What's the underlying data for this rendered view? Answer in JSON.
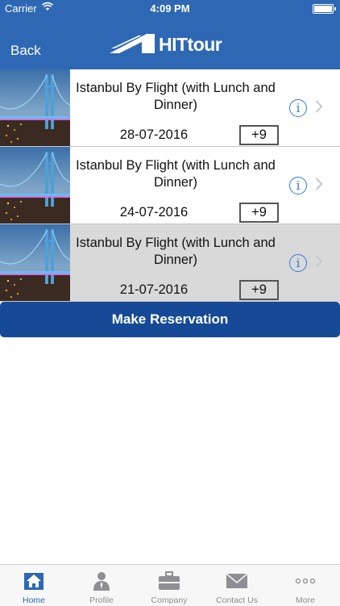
{
  "status_bar": {
    "carrier": "Carrier",
    "time": "4:09 PM"
  },
  "header": {
    "back_label": "Back",
    "logo_text": "HITtour",
    "background": "#2e68b4"
  },
  "tours": [
    {
      "title": "Istanbul By Flight (with Lunch and Dinner)",
      "date": "28-07-2016",
      "count": "+9",
      "selected": false
    },
    {
      "title": "Istanbul By Flight (with Lunch and Dinner)",
      "date": "24-07-2016",
      "count": "+9",
      "selected": false
    },
    {
      "title": "Istanbul By Flight (with Lunch and Dinner)",
      "date": "21-07-2016",
      "count": "+9",
      "selected": true
    }
  ],
  "reserve_button": {
    "label": "Make Reservation",
    "background": "#164a96"
  },
  "tab_bar": {
    "active_tab": "Home",
    "tabs": [
      {
        "label": "Home",
        "icon": "home-icon"
      },
      {
        "label": "Profile",
        "icon": "profile-icon"
      },
      {
        "label": "Company",
        "icon": "briefcase-icon"
      },
      {
        "label": "Contact Us",
        "icon": "mail-icon"
      },
      {
        "label": "More",
        "icon": "more-icon"
      }
    ]
  }
}
